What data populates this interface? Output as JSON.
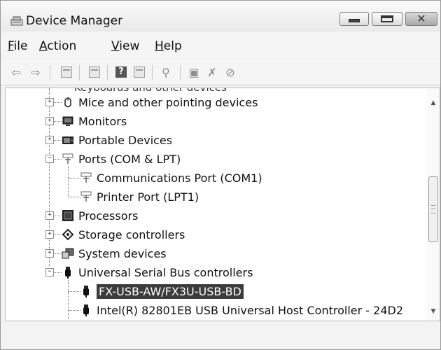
{
  "window": {
    "title": "Device Manager"
  },
  "menu": [
    {
      "first": "F",
      "rest": "ile"
    },
    {
      "first": "A",
      "rest": "ction"
    },
    {
      "first": "V",
      "rest": "iew"
    },
    {
      "first": "H",
      "rest": "elp"
    }
  ],
  "toolbar": {
    "icons": [
      "back-arrow-icon",
      "forward-arrow-icon",
      "properties-icon",
      "show-hide-tree-icon",
      "help-icon",
      "console-icon",
      "scan-hardware-icon",
      "update-driver-icon",
      "uninstall-icon",
      "disable-device-icon"
    ]
  },
  "tree": {
    "cut_row": "Keyboards and other devices",
    "items": [
      {
        "label": "Mice and other pointing devices",
        "icon": "mouse-icon",
        "expanded": false
      },
      {
        "label": "Monitors",
        "icon": "monitor-icon",
        "expanded": false
      },
      {
        "label": "Portable Devices",
        "icon": "portable-device-icon",
        "expanded": false
      },
      {
        "label": "Ports (COM & LPT)",
        "icon": "port-icon",
        "expanded": true
      },
      {
        "label": "Communications Port (COM1)",
        "icon": "port-icon"
      },
      {
        "label": "Printer Port (LPT1)",
        "icon": "port-icon"
      },
      {
        "label": "Processors",
        "icon": "processor-icon",
        "expanded": false
      },
      {
        "label": "Storage controllers",
        "icon": "storage-controller-icon",
        "expanded": false
      },
      {
        "label": "System devices",
        "icon": "system-device-icon",
        "expanded": false
      },
      {
        "label": "Universal Serial Bus controllers",
        "icon": "usb-icon",
        "expanded": true
      },
      {
        "label": "FX-USB-AW/FX3U-USB-BD",
        "icon": "usb-icon",
        "selected": true
      },
      {
        "label": "Intel(R) 82801EB USB Universal Host Controller - 24D2",
        "icon": "usb-icon"
      }
    ]
  },
  "scrollbar": {
    "thumb_position": 0.5
  }
}
